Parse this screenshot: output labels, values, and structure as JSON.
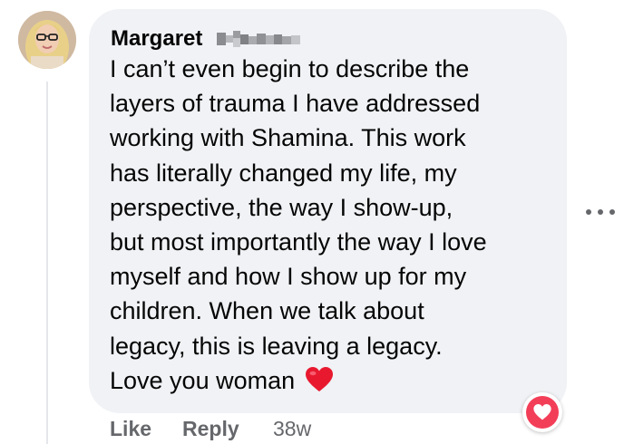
{
  "comment": {
    "author_first_name": "Margaret",
    "text_lines": [
      "I can’t even begin to describe the",
      "layers of trauma I have addressed",
      "working with Shamina. This work",
      "has literally changed my life, my",
      "perspective, the way I show-up,",
      "but most importantly the way I love",
      "myself and how I show up for my",
      "children. When we talk about",
      "legacy, this is leaving a legacy.",
      "Love you woman"
    ],
    "trailing_emoji": "red-heart-emoji",
    "reaction": "love-reaction-icon"
  },
  "actions": {
    "like_label": "Like",
    "reply_label": "Reply",
    "timestamp": "38w"
  },
  "colors": {
    "bubble": "#f0f2f5",
    "text": "#050505",
    "secondary_text": "#65676b",
    "love_reaction": "#f33e58",
    "heart_emoji": "#e8192f"
  }
}
